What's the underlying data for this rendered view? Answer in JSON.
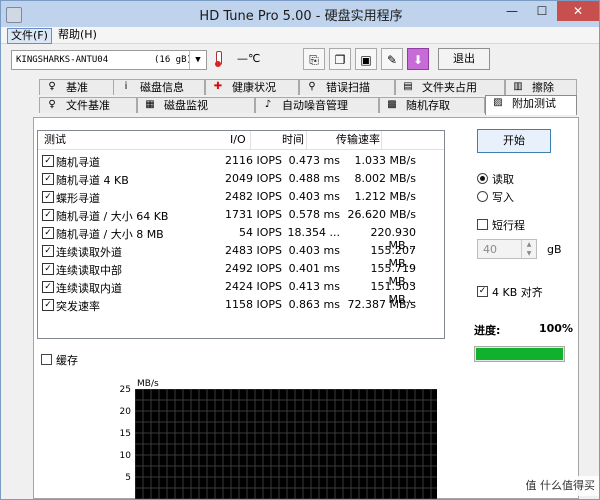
{
  "window": {
    "title": "HD Tune Pro 5.00 - 硬盘实用程序",
    "controls": {
      "minimize": "—",
      "maximize": "☐",
      "close": "✕"
    }
  },
  "menu": {
    "file": "文件(F)",
    "help": "帮助(H)"
  },
  "toolbar": {
    "drive_name": "KINGSHARKS-ANTU04",
    "drive_size": "(16 gB)",
    "temperature": "—℃",
    "exit_label": "退出",
    "buttons": [
      {
        "icon": "copy-icon",
        "glyph": "⎘"
      },
      {
        "icon": "copy-info-icon",
        "glyph": "❐"
      },
      {
        "icon": "save-icon",
        "glyph": "▣"
      },
      {
        "icon": "options-icon",
        "glyph": "✎"
      },
      {
        "icon": "download-icon",
        "glyph": "⬇"
      }
    ]
  },
  "tabs_top": [
    {
      "label": "基准",
      "icon": "benchmark-icon",
      "glyph": "♀"
    },
    {
      "label": "磁盘信息",
      "icon": "info-icon",
      "glyph": "i"
    },
    {
      "label": "健康状况",
      "icon": "health-icon",
      "glyph": "✚"
    },
    {
      "label": "错误扫描",
      "icon": "scan-icon",
      "glyph": "⚲"
    },
    {
      "label": "文件夹占用",
      "icon": "folder-icon",
      "glyph": "▤"
    },
    {
      "label": "擦除",
      "icon": "erase-icon",
      "glyph": "▥"
    }
  ],
  "tabs_bottom": [
    {
      "label": "文件基准",
      "icon": "file-benchmark-icon",
      "glyph": "♀"
    },
    {
      "label": "磁盘监视",
      "icon": "monitor-icon",
      "glyph": "▦"
    },
    {
      "label": "自动噪音管理",
      "icon": "noise-icon",
      "glyph": "♪"
    },
    {
      "label": "随机存取",
      "icon": "random-access-icon",
      "glyph": "▩"
    },
    {
      "label": "附加测试",
      "icon": "extra-tests-icon",
      "glyph": "▨"
    }
  ],
  "list": {
    "headers": [
      "测试",
      "I/O",
      "时间",
      "传输速率"
    ],
    "rows": [
      {
        "name": "随机寻道",
        "io": "2116 IOPS",
        "time": "0.473 ms",
        "rate": "1.033 MB/s"
      },
      {
        "name": "随机寻道 4 KB",
        "io": "2049 IOPS",
        "time": "0.488 ms",
        "rate": "8.002 MB/s"
      },
      {
        "name": "蝶形寻道",
        "io": "2482 IOPS",
        "time": "0.403 ms",
        "rate": "1.212 MB/s"
      },
      {
        "name": "随机寻道 / 大小 64 KB",
        "io": "1731 IOPS",
        "time": "0.578 ms",
        "rate": "26.620 MB/s"
      },
      {
        "name": "随机寻道 / 大小 8 MB",
        "io": "54 IOPS",
        "time": "18.354 ...",
        "rate": "220.930 MB..."
      },
      {
        "name": "连续读取外道",
        "io": "2483 IOPS",
        "time": "0.403 ms",
        "rate": "155.207 MB..."
      },
      {
        "name": "连续读取中部",
        "io": "2492 IOPS",
        "time": "0.401 ms",
        "rate": "155.719 MB..."
      },
      {
        "name": "连续读取内道",
        "io": "2424 IOPS",
        "time": "0.413 ms",
        "rate": "151.503 MB..."
      },
      {
        "name": "突发速率",
        "io": "1158 IOPS",
        "time": "0.863 ms",
        "rate": "72.387 MB/s"
      }
    ]
  },
  "side": {
    "start_label": "开始",
    "read_label": "读取",
    "write_label": "写入",
    "short_stroke_label": "短行程",
    "short_stroke_value": "40",
    "short_stroke_unit": "gB",
    "align_label": "4 KB 对齐",
    "progress_label": "进度:",
    "progress_value": "100%",
    "progress_fraction": 1.0
  },
  "cache_label": "缓存",
  "chart": {
    "unit": "MB/s",
    "ticks": [
      "25",
      "20",
      "15",
      "10",
      "5"
    ]
  },
  "watermark": "值 什么值得买"
}
